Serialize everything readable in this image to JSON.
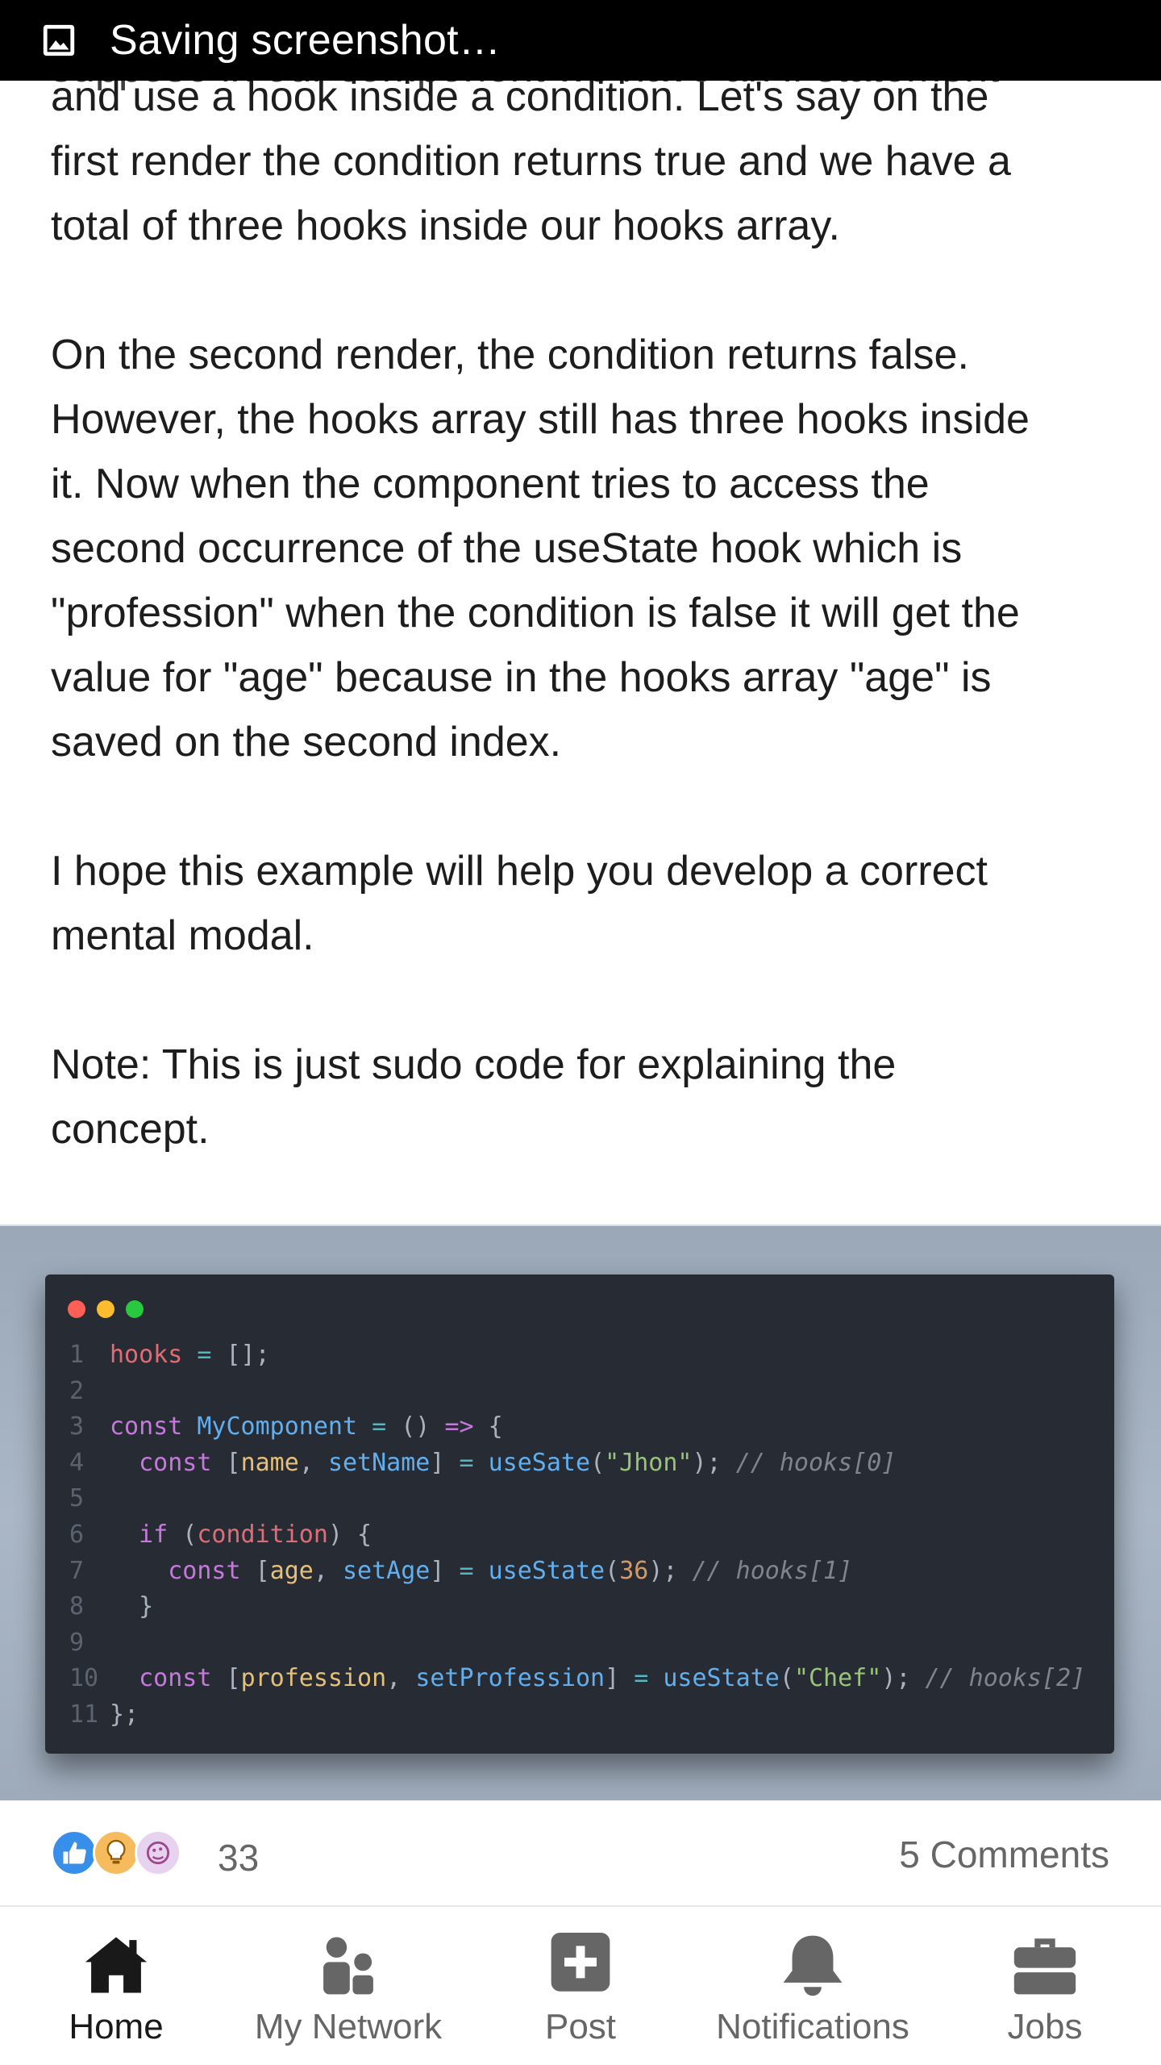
{
  "status_bar": {
    "text": "Saving screenshot…",
    "icon": "image-icon"
  },
  "article": {
    "clipped_line": "suppose in our component we have an if statement",
    "paragraphs": [
      "and use a hook inside a condition. Let's say on the\nfirst render the condition returns true and we have a\ntotal of three hooks inside our hooks array.",
      "On the second render, the condition returns false.\nHowever, the hooks array still has three hooks inside\nit. Now when the component tries to access the\nsecond occurrence of the useState hook which is\n\"profession\" when the condition is false it will get the\nvalue for \"age\" because in the hooks array \"age\" is\nsaved on the second index.",
      "I hope this example will help you develop a correct\nmental modal.",
      "Note: This is just sudo code for explaining the\nconcept."
    ]
  },
  "code_image": {
    "window_dots": [
      "#ff5f57",
      "#febc2e",
      "#28c840"
    ],
    "lines": [
      {
        "n": "1",
        "tokens": [
          [
            "var",
            "hooks"
          ],
          [
            "pl",
            " "
          ],
          [
            "op",
            "="
          ],
          [
            "pl",
            " [];"
          ]
        ]
      },
      {
        "n": "2",
        "tokens": []
      },
      {
        "n": "3",
        "tokens": [
          [
            "kw",
            "const"
          ],
          [
            "pl",
            " "
          ],
          [
            "fn",
            "MyComponent"
          ],
          [
            "pl",
            " "
          ],
          [
            "op",
            "="
          ],
          [
            "pl",
            " () "
          ],
          [
            "kw",
            "=>"
          ],
          [
            "pl",
            " {"
          ]
        ]
      },
      {
        "n": "4",
        "tokens": [
          [
            "pl",
            "  "
          ],
          [
            "kw",
            "const"
          ],
          [
            "pl",
            " ["
          ],
          [
            "prop",
            "name"
          ],
          [
            "pl",
            ", "
          ],
          [
            "fn",
            "setName"
          ],
          [
            "pl",
            "] "
          ],
          [
            "op",
            "="
          ],
          [
            "pl",
            " "
          ],
          [
            "fn",
            "useSate"
          ],
          [
            "pl",
            "("
          ],
          [
            "str",
            "\"Jhon\""
          ],
          [
            "pl",
            "); "
          ],
          [
            "cm",
            "// hooks[0]"
          ]
        ]
      },
      {
        "n": "5",
        "tokens": []
      },
      {
        "n": "6",
        "tokens": [
          [
            "pl",
            "  "
          ],
          [
            "kw",
            "if"
          ],
          [
            "pl",
            " ("
          ],
          [
            "var",
            "condition"
          ],
          [
            "pl",
            ") {"
          ]
        ]
      },
      {
        "n": "7",
        "tokens": [
          [
            "pl",
            "    "
          ],
          [
            "kw",
            "const"
          ],
          [
            "pl",
            " ["
          ],
          [
            "prop",
            "age"
          ],
          [
            "pl",
            ", "
          ],
          [
            "fn",
            "setAge"
          ],
          [
            "pl",
            "] "
          ],
          [
            "op",
            "="
          ],
          [
            "pl",
            " "
          ],
          [
            "fn",
            "useState"
          ],
          [
            "pl",
            "("
          ],
          [
            "num",
            "36"
          ],
          [
            "pl",
            "); "
          ],
          [
            "cm",
            "// hooks[1]"
          ]
        ]
      },
      {
        "n": "8",
        "tokens": [
          [
            "pl",
            "  }"
          ]
        ]
      },
      {
        "n": "9",
        "tokens": []
      },
      {
        "n": "10",
        "tokens": [
          [
            "pl",
            "  "
          ],
          [
            "kw",
            "const"
          ],
          [
            "pl",
            " ["
          ],
          [
            "prop",
            "profession"
          ],
          [
            "pl",
            ", "
          ],
          [
            "fn",
            "setProfession"
          ],
          [
            "pl",
            "] "
          ],
          [
            "op",
            "="
          ],
          [
            "pl",
            " "
          ],
          [
            "fn",
            "useState"
          ],
          [
            "pl",
            "("
          ],
          [
            "str",
            "\"Chef\""
          ],
          [
            "pl",
            "); "
          ],
          [
            "cm",
            "// hooks[2]"
          ]
        ]
      },
      {
        "n": "11",
        "tokens": [
          [
            "pl",
            "};"
          ]
        ]
      }
    ]
  },
  "reactions": {
    "icons": [
      "like-icon",
      "insightful-icon",
      "celebrate-icon"
    ],
    "count": "33",
    "comments_label": "5 Comments"
  },
  "bottom_nav": {
    "items": [
      {
        "label": "Home",
        "icon": "home-icon",
        "active": true
      },
      {
        "label": "My Network",
        "icon": "network-icon",
        "active": false
      },
      {
        "label": "Post",
        "icon": "post-icon",
        "active": false
      },
      {
        "label": "Notifications",
        "icon": "bell-icon",
        "active": false
      },
      {
        "label": "Jobs",
        "icon": "briefcase-icon",
        "active": false
      }
    ]
  }
}
